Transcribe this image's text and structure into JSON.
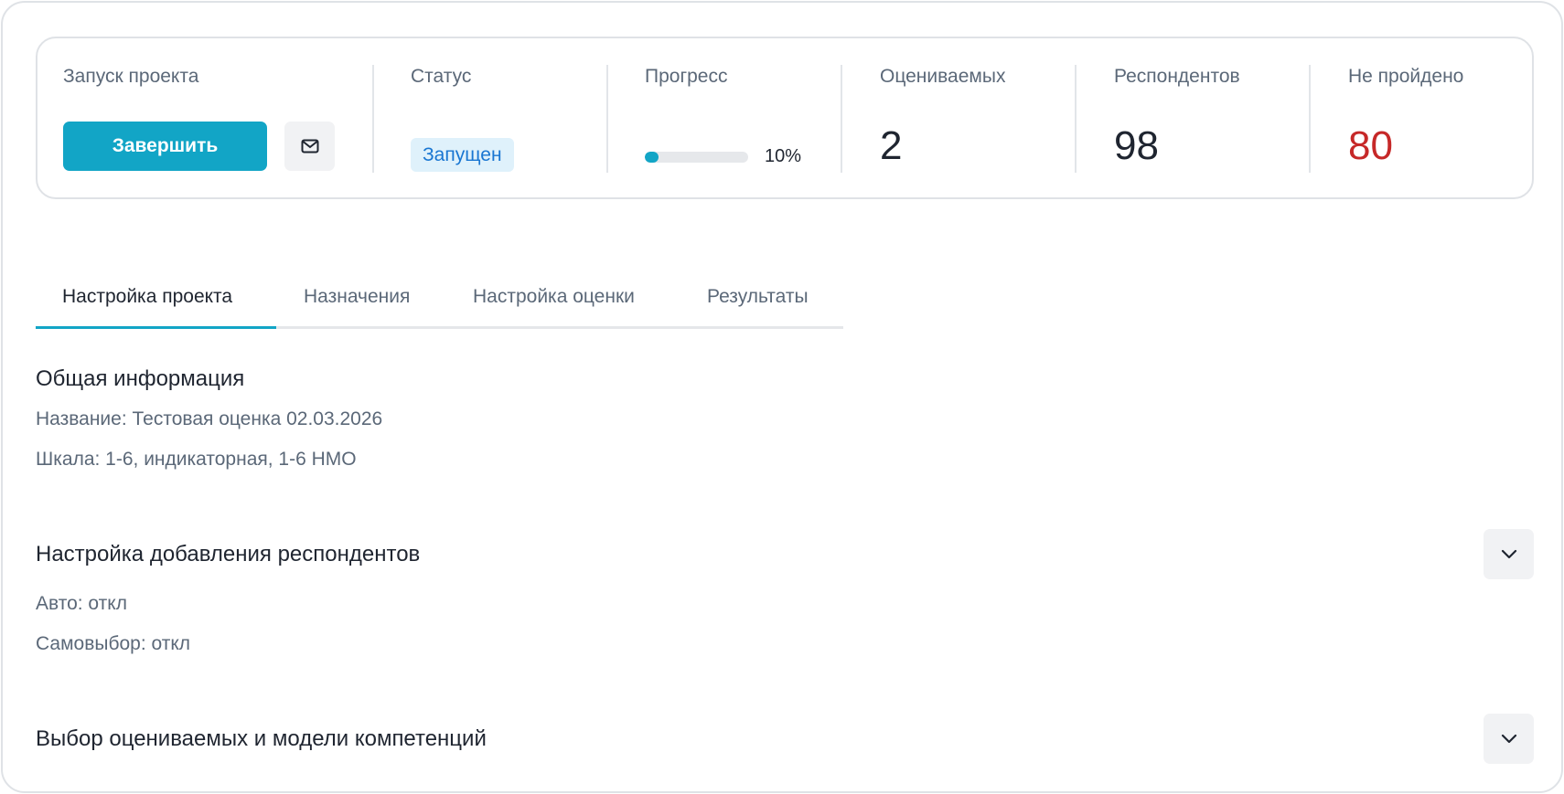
{
  "stats": {
    "launch": {
      "label": "Запуск проекта",
      "finish_label": "Завершить",
      "mail_icon": "mail-icon"
    },
    "status": {
      "label": "Статус",
      "value": "Запущен",
      "badge_color": "#dff1fb",
      "badge_text_color": "#1976d2"
    },
    "progress": {
      "label": "Прогресс",
      "percent": 10,
      "text": "10%"
    },
    "evaluated": {
      "label": "Оцениваемых",
      "value": "2"
    },
    "respondents": {
      "label": "Респондентов",
      "value": "98"
    },
    "not_passed": {
      "label": "Не пройдено",
      "value": "80",
      "color": "#c62828"
    }
  },
  "tabs": [
    {
      "label": "Настройка проекта",
      "active": true
    },
    {
      "label": "Назначения",
      "active": false
    },
    {
      "label": "Настройка оценки",
      "active": false
    },
    {
      "label": "Результаты",
      "active": false
    }
  ],
  "general": {
    "title": "Общая информация",
    "name_line": "Название: Тестовая оценка 02.03.2026",
    "scale_line": "Шкала: 1-6, индикаторная, 1-6 НМО"
  },
  "respondents_settings": {
    "title": "Настройка добавления респондентов",
    "auto_line": "Авто: откл",
    "self_line": "Самовыбор: откл",
    "toggle_icon": "chevron-down-icon"
  },
  "evaluated_selection": {
    "title": "Выбор оцениваемых и модели компетенций",
    "toggle_icon": "chevron-down-icon"
  },
  "colors": {
    "accent": "#12a5c6",
    "text": "#1f2530",
    "muted": "#5b6878"
  }
}
